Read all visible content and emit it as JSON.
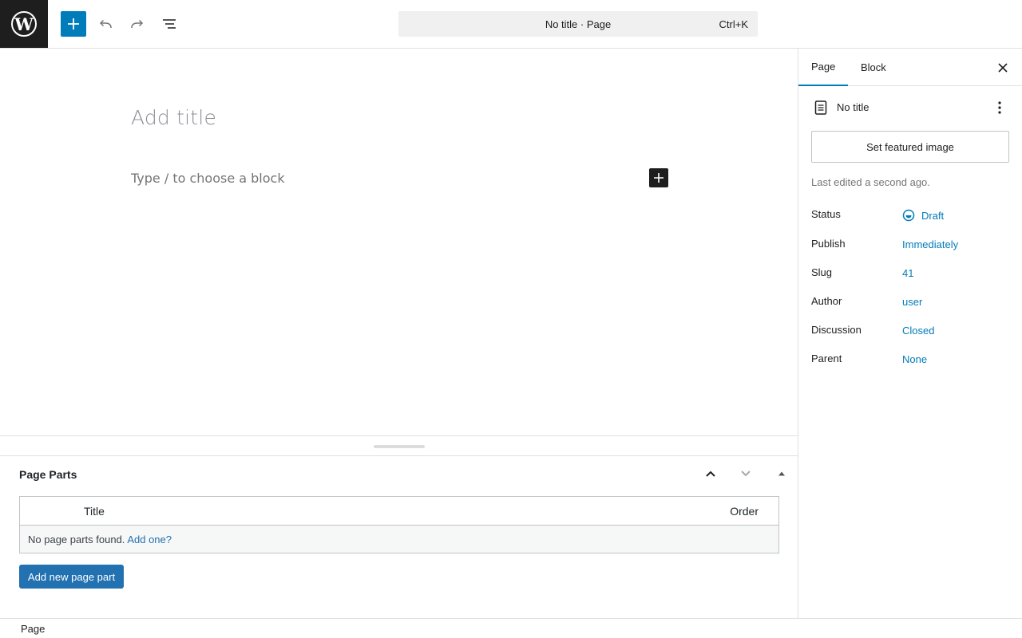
{
  "topbar": {
    "logo_icon": "wordpress-logo-icon",
    "command_title": "No title · Page",
    "command_shortcut": "Ctrl+K"
  },
  "editor": {
    "title_placeholder": "Add title",
    "block_placeholder": "Type / to choose a block"
  },
  "metabox": {
    "title": "Page Parts",
    "columns": [
      "Title",
      "Order"
    ],
    "empty_text": "No page parts found.",
    "empty_link": "Add one?",
    "add_button": "Add new page part"
  },
  "statusbar": {
    "breadcrumb": "Page"
  },
  "sidebar": {
    "tabs": [
      "Page",
      "Block"
    ],
    "doc_title": "No title",
    "featured_button": "Set featured image",
    "last_edited": "Last edited a second ago.",
    "rows": [
      {
        "label": "Status",
        "value": "Draft"
      },
      {
        "label": "Publish",
        "value": "Immediately"
      },
      {
        "label": "Slug",
        "value": "41"
      },
      {
        "label": "Author",
        "value": "user"
      },
      {
        "label": "Discussion",
        "value": "Closed"
      },
      {
        "label": "Parent",
        "value": "None"
      }
    ]
  },
  "colors": {
    "accent": "#007cba",
    "button_primary": "#2271b1",
    "dark": "#1e1e1e"
  }
}
